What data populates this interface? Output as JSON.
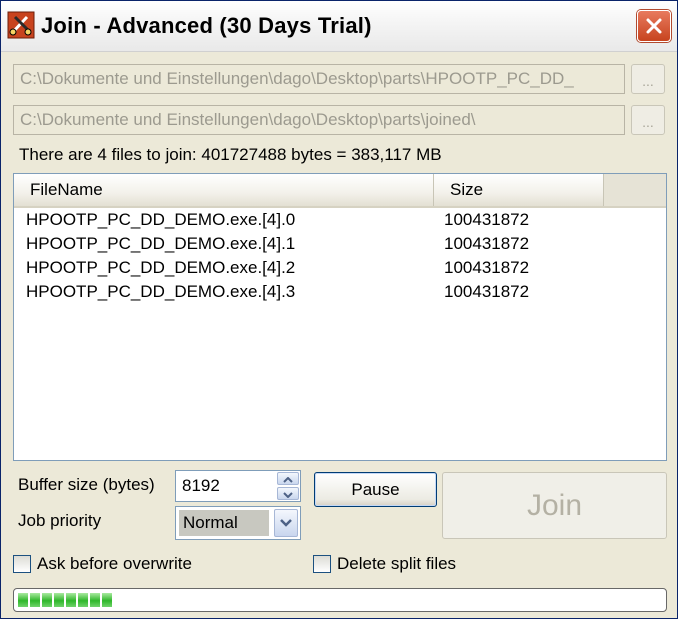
{
  "window": {
    "title": "Join - Advanced (30 Days Trial)",
    "icon": "app-scissors-icon",
    "close_icon": "close-icon"
  },
  "source_path": {
    "value": "C:\\Dokumente und Einstellungen\\dago\\Desktop\\parts\\HPOOTP_PC_DD_",
    "browse_label": "..."
  },
  "target_path": {
    "value": "C:\\Dokumente und Einstellungen\\dago\\Desktop\\parts\\joined\\",
    "browse_label": "..."
  },
  "summary": "There are 4 files to join: 401727488 bytes = 383,117 MB",
  "file_list": {
    "columns": [
      "FileName",
      "Size"
    ],
    "rows": [
      {
        "name": "HPOOTP_PC_DD_DEMO.exe.[4].0",
        "size": "100431872"
      },
      {
        "name": "HPOOTP_PC_DD_DEMO.exe.[4].1",
        "size": "100431872"
      },
      {
        "name": "HPOOTP_PC_DD_DEMO.exe.[4].2",
        "size": "100431872"
      },
      {
        "name": "HPOOTP_PC_DD_DEMO.exe.[4].3",
        "size": "100431872"
      }
    ]
  },
  "buffer": {
    "label": "Buffer size (bytes)",
    "value": "8192"
  },
  "priority": {
    "label": "Job priority",
    "selected": "Normal"
  },
  "buttons": {
    "pause": "Pause",
    "join": "Join"
  },
  "options": {
    "ask_overwrite": {
      "label": "Ask before overwrite",
      "checked": false
    },
    "delete_split": {
      "label": "Delete split files",
      "checked": false
    }
  },
  "progress": {
    "fraction": 0.15
  },
  "colors": {
    "window_bg": "#ece9d8",
    "close_red": "#c7441f",
    "progress_green": "#2fb72a",
    "disabled_text": "#b4b1a4"
  }
}
